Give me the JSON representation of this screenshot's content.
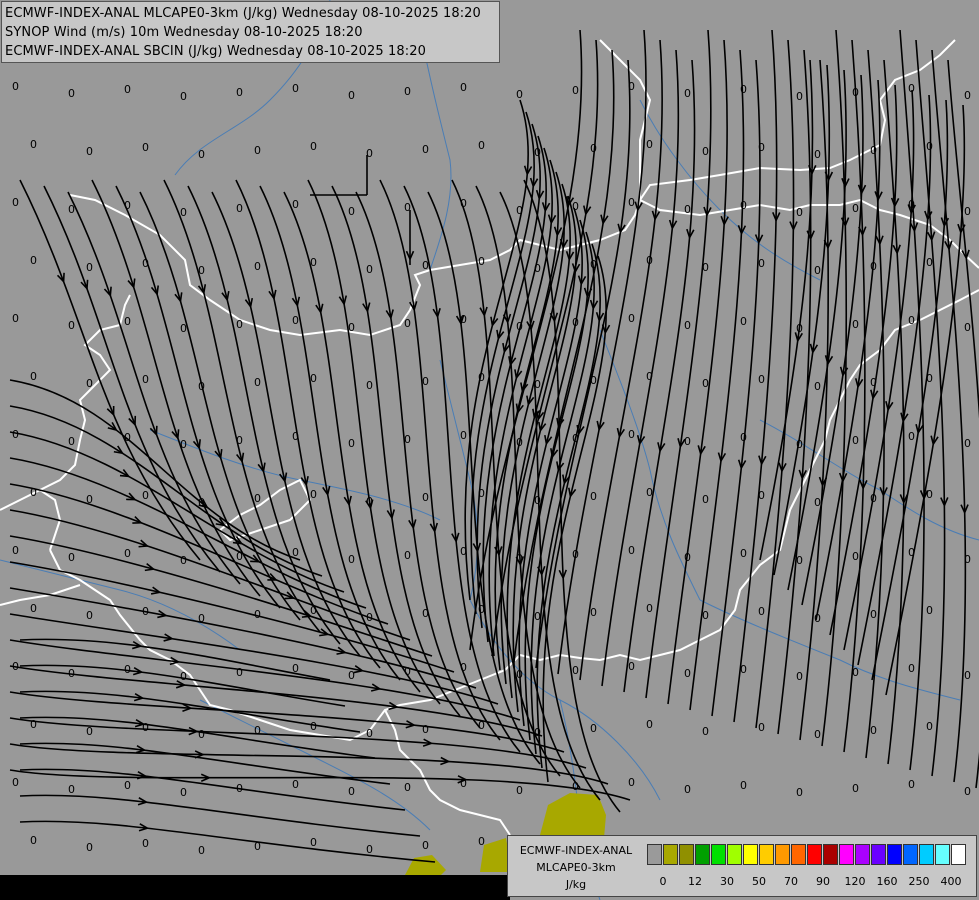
{
  "titles": {
    "line1": "ECMWF-INDEX-ANAL MLCAPE0-3km (J/kg) Wednesday 08-10-2025 18:20",
    "line2": "SYNOP Wind (m/s) 10m Wednesday 08-10-2025 18:20",
    "line3": "ECMWF-INDEX-ANAL SBCIN (J/kg) Wednesday 08-10-2025 18:20"
  },
  "legend": {
    "title1": "ECMWF-INDEX-ANAL",
    "title2": "MLCAPE0-3km",
    "unit": "J/kg",
    "ticks": [
      "0",
      "12",
      "30",
      "50",
      "70",
      "90",
      "120",
      "160",
      "250",
      "400"
    ],
    "colors": [
      "#9a9a9a",
      "#a8a800",
      "#909000",
      "#00a000",
      "#00e000",
      "#a0ff00",
      "#ffff00",
      "#ffcc00",
      "#ff9900",
      "#ff6600",
      "#ff0000",
      "#aa0000",
      "#ff00ff",
      "#aa00ff",
      "#6a00ff",
      "#0000ff",
      "#0066ff",
      "#00ccff",
      "#66ffff",
      "#ffffff"
    ]
  },
  "map": {
    "value_label": "0",
    "colors": {
      "background": "#999999",
      "border": "#ffffff",
      "river": "#4a7db5",
      "streamline": "#000000",
      "cape_fill": "#a8a800"
    }
  }
}
